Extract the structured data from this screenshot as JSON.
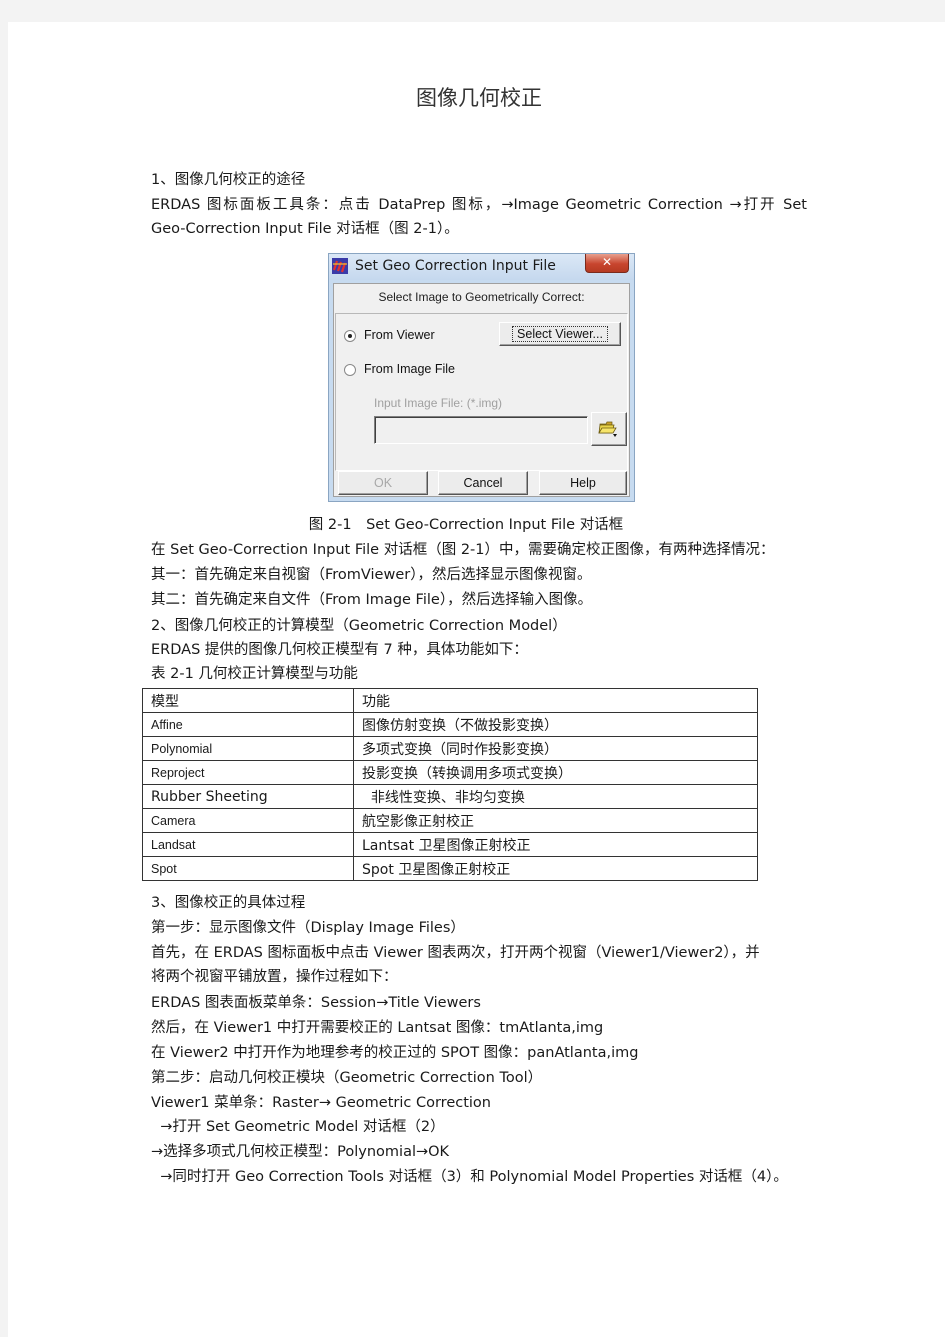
{
  "document": {
    "title": "图像几何校正",
    "section1": {
      "heading": "1、图像几何校正的途径",
      "para_line1": "ERDAS 图标面板工具条：点击 DataPrep 图标，→Image Geometric Correction →打开 Set",
      "para_line2": "Geo-Correction Input File 对话框（图 2-1）。"
    },
    "figure": {
      "caption": "图 2-1　Set Geo-Correction Input File 对话框",
      "dialog": {
        "title": "Set Geo Correction Input File",
        "close_glyph": "✕",
        "header": "Select Image to Geometrically Correct:",
        "radio_from_viewer": "From Viewer",
        "radio_from_viewer_selected": true,
        "radio_from_file": "From Image File",
        "radio_from_file_selected": false,
        "select_viewer_button": "Select Viewer...",
        "input_label": "Input Image File: (*.img)",
        "input_value": "",
        "ok_button": "OK",
        "cancel_button": "Cancel",
        "help_button": "Help"
      }
    },
    "explain_line1": "在 Set Geo-Correction Input File 对话框（图 2-1）中，需要确定校正图像，有两种选择情况：",
    "explain_line2": "其一：首先确定来自视窗（FromViewer），然后选择显示图像视窗。",
    "explain_line3": "其二：首先确定来自文件（From Image File），然后选择输入图像。",
    "section2": {
      "heading": "2、图像几何校正的计算模型（Geometric Correction Model）",
      "intro": "ERDAS 提供的图像几何校正模型有 7 种，具体功能如下：",
      "table_caption": "表 2-1  几何校正计算模型与功能",
      "table": {
        "headers": [
          "模型",
          "功能"
        ],
        "rows": [
          [
            "Affine",
            "图像仿射变换（不做投影变换）"
          ],
          [
            "Polynomial",
            "多项式变换（同时作投影变换）"
          ],
          [
            "Reproject",
            "投影变换（转换调用多项式变换）"
          ],
          [
            "Rubber Sheeting",
            "  非线性变换、非均匀变换"
          ],
          [
            "Camera",
            "航空影像正射校正"
          ],
          [
            "Landsat",
            "Lantsat 卫星图像正射校正"
          ],
          [
            "Spot",
            "Spot 卫星图像正射校正"
          ]
        ]
      }
    },
    "section3": {
      "heading": "3、图像校正的具体过程",
      "step1": "第一步：显示图像文件（Display Image Files）",
      "step1_line1": "首先，在 ERDAS 图标面板中点击 Viewer 图表两次，打开两个视窗（Viewer1/Viewer2），并",
      "step1_line2": "将两个视窗平铺放置，操作过程如下：",
      "step1_line3": "ERDAS 图表面板菜单条：Session→Title Viewers",
      "step1_line4": "然后，在 Viewer1 中打开需要校正的 Lantsat 图像：tmAtlanta,img",
      "step1_line5": "在 Viewer2 中打开作为地理参考的校正过的 SPOT 图像：panAtlanta,img",
      "step2": "第二步：启动几何校正模块（Geometric Correction Tool）",
      "step2_line1": "Viewer1 菜单条：Raster→ Geometric Correction",
      "step2_line2": "  →打开 Set Geometric Model 对话框（2）",
      "step2_line3": "→选择多项式几何校正模型：Polynomial→OK",
      "step2_line4": "  →同时打开 Geo Correction Tools 对话框（3）和 Polynomial Model Properties 对话框（4）。"
    }
  }
}
